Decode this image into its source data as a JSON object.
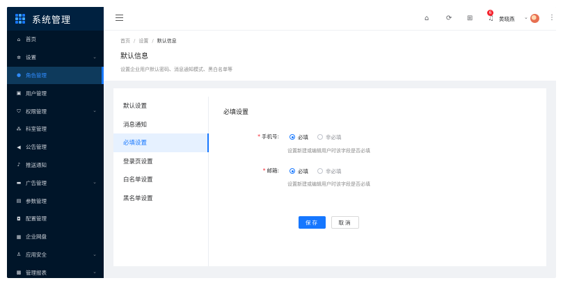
{
  "brand": {
    "title": "系统管理",
    "logo_icon": "grid-logo-icon"
  },
  "sidebar": {
    "items": [
      {
        "label": "首页",
        "icon": "home-icon",
        "glyph": "⌂",
        "has_arrow": false,
        "active": false
      },
      {
        "label": "设置",
        "icon": "gear-icon",
        "glyph": "✲",
        "has_arrow": true,
        "active": false
      },
      {
        "label": "角色管理",
        "icon": "user-circle-icon",
        "glyph": "●",
        "has_arrow": false,
        "active": true
      },
      {
        "label": "用户管理",
        "icon": "id-card-icon",
        "glyph": "▣",
        "has_arrow": false,
        "active": false
      },
      {
        "label": "权限管理",
        "icon": "shield-icon",
        "glyph": "⛉",
        "has_arrow": true,
        "active": false
      },
      {
        "label": "科室管理",
        "icon": "team-icon",
        "glyph": "⁂",
        "has_arrow": false,
        "active": false
      },
      {
        "label": "公告管理",
        "icon": "megaphone-icon",
        "glyph": "◀",
        "has_arrow": false,
        "active": false
      },
      {
        "label": "推送通知",
        "icon": "bell-icon",
        "glyph": "♪",
        "has_arrow": false,
        "active": false
      },
      {
        "label": "广告管理",
        "icon": "picture-icon",
        "glyph": "▬",
        "has_arrow": true,
        "active": false
      },
      {
        "label": "参数管理",
        "icon": "sliders-icon",
        "glyph": "▤",
        "has_arrow": false,
        "active": false
      },
      {
        "label": "配置管理",
        "icon": "config-icon",
        "glyph": "◘",
        "has_arrow": false,
        "active": false
      },
      {
        "label": "企业网盘",
        "icon": "cloud-grid-icon",
        "glyph": "▦",
        "has_arrow": false,
        "active": false
      },
      {
        "label": "应用安全",
        "icon": "lock-user-icon",
        "glyph": "♙",
        "has_arrow": true,
        "active": false
      },
      {
        "label": "管理报表",
        "icon": "report-icon",
        "glyph": "▩",
        "has_arrow": true,
        "active": false
      }
    ]
  },
  "header": {
    "notification_count": "6",
    "user_name": "黄晓燕",
    "icons": [
      "menu-toggle-icon",
      "home-icon",
      "refresh-icon",
      "apps-icon",
      "bell-icon",
      "more-vertical-icon"
    ]
  },
  "page": {
    "breadcrumb": [
      "首页",
      "设置",
      "默认信息"
    ],
    "breadcrumb_sep": "/",
    "title": "默认信息",
    "description": "设置企业用户默认密码、消息通知模式、黑白名单等"
  },
  "tabs": [
    {
      "label": "默认设置",
      "active": false
    },
    {
      "label": "消息通知",
      "active": false
    },
    {
      "label": "必填设置",
      "active": true
    },
    {
      "label": "登录页设置",
      "active": false
    },
    {
      "label": "白名单设置",
      "active": false
    },
    {
      "label": "黑名单设置",
      "active": false
    }
  ],
  "form": {
    "title": "必填设置",
    "fields": [
      {
        "label": "手机号:",
        "required_mark": "*",
        "option_required": "必填",
        "option_optional": "非必填",
        "selected": "required",
        "hint": "设置新建或编辑用户时该字段是否必填"
      },
      {
        "label": "邮箱:",
        "required_mark": "*",
        "option_required": "必填",
        "option_optional": "非必填",
        "selected": "required",
        "hint": "设置新建或编辑用户时该字段是否必填"
      }
    ],
    "save_label": "保存",
    "cancel_label": "取消"
  },
  "colors": {
    "primary": "#1677ff",
    "sidebar_bg": "#001529",
    "danger": "#f5222d"
  }
}
